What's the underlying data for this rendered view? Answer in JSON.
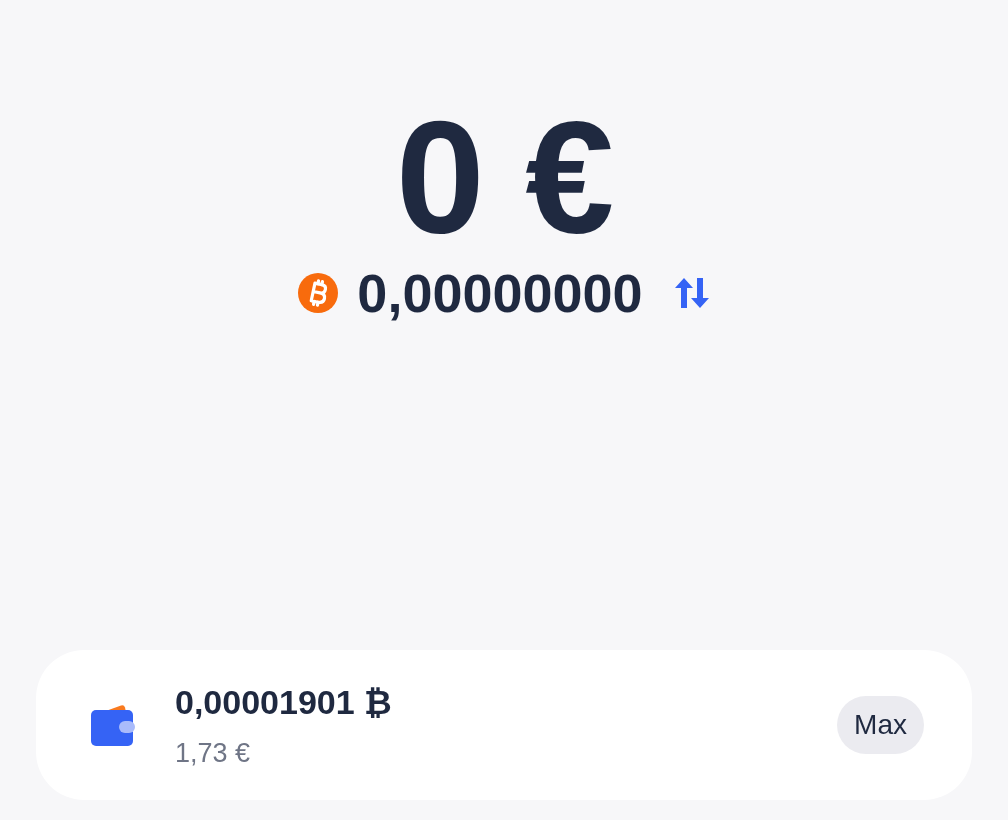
{
  "amount": {
    "fiat": "0 €",
    "crypto": "0,00000000"
  },
  "balance_card": {
    "crypto": "0,00001901 ₿",
    "fiat": "1,73 €",
    "button": "Max"
  }
}
